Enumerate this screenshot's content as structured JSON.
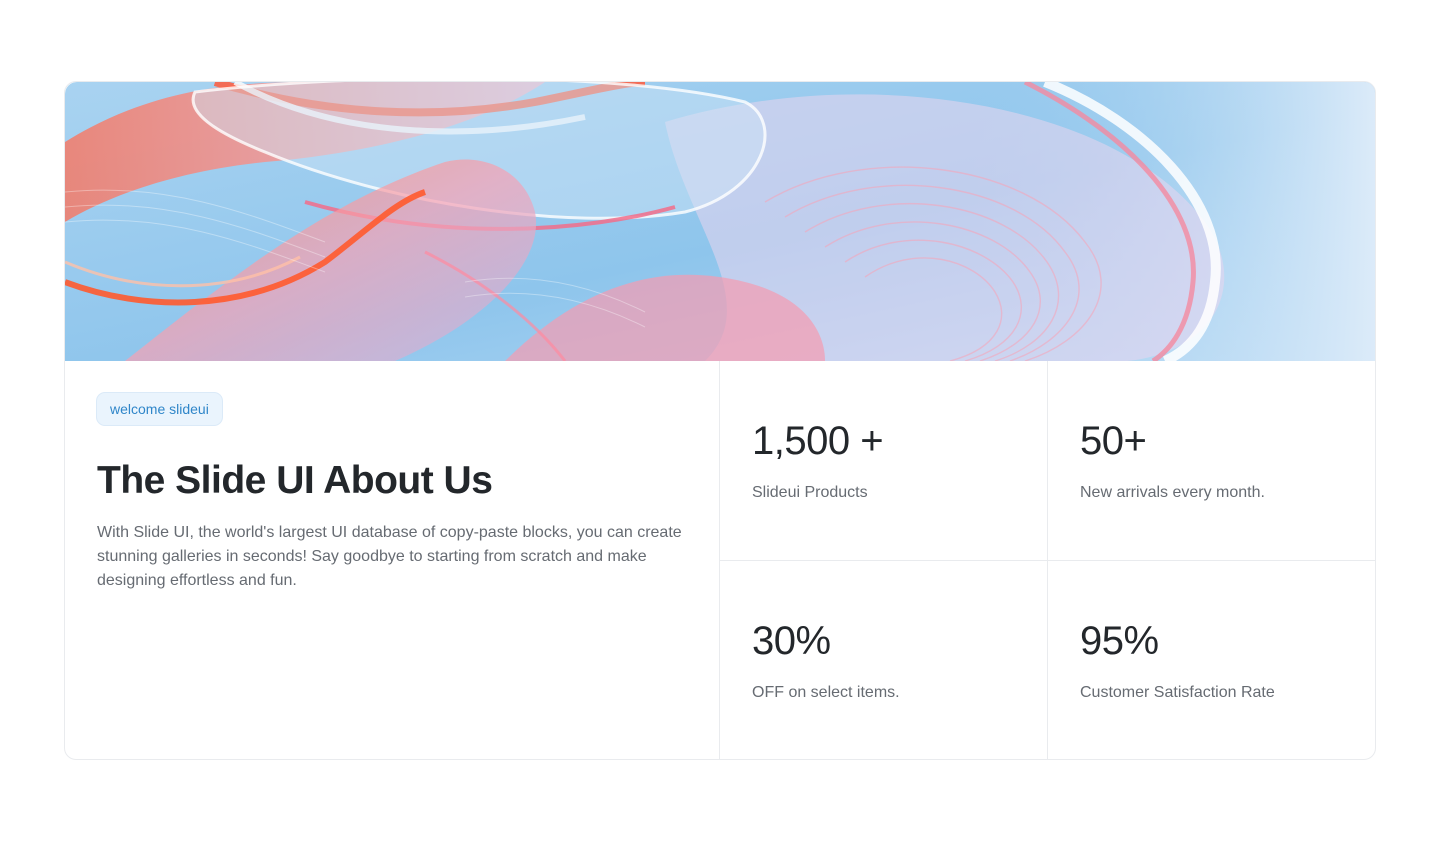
{
  "hero": {
    "image_icon": "abstract-glass-ribbons-image",
    "colors": {
      "sky_light": "#d7e8f8",
      "sky_blue": "#8ec5ec",
      "coral": "#ff6f55",
      "pink": "#f6a1b4",
      "lavender": "#c9b7e0"
    }
  },
  "about": {
    "badge": "welcome slideui",
    "title": "The Slide UI About Us",
    "description": "With Slide UI, the world's largest UI database of copy-paste blocks, you can create stunning galleries in seconds! Say goodbye to starting from scratch and make designing effortless and fun."
  },
  "stats": [
    {
      "value": "1,500 +",
      "label": "Slideui Products"
    },
    {
      "value": "50+",
      "label": "New arrivals every month."
    },
    {
      "value": "30%",
      "label": "OFF on select items."
    },
    {
      "value": "95%",
      "label": "Customer Satisfaction Rate"
    }
  ],
  "colors": {
    "heading": "#23272b",
    "body_text": "#666b72",
    "badge_text": "#2f86c9",
    "badge_bg": "#eaf4fd",
    "border": "#e9ebee"
  }
}
